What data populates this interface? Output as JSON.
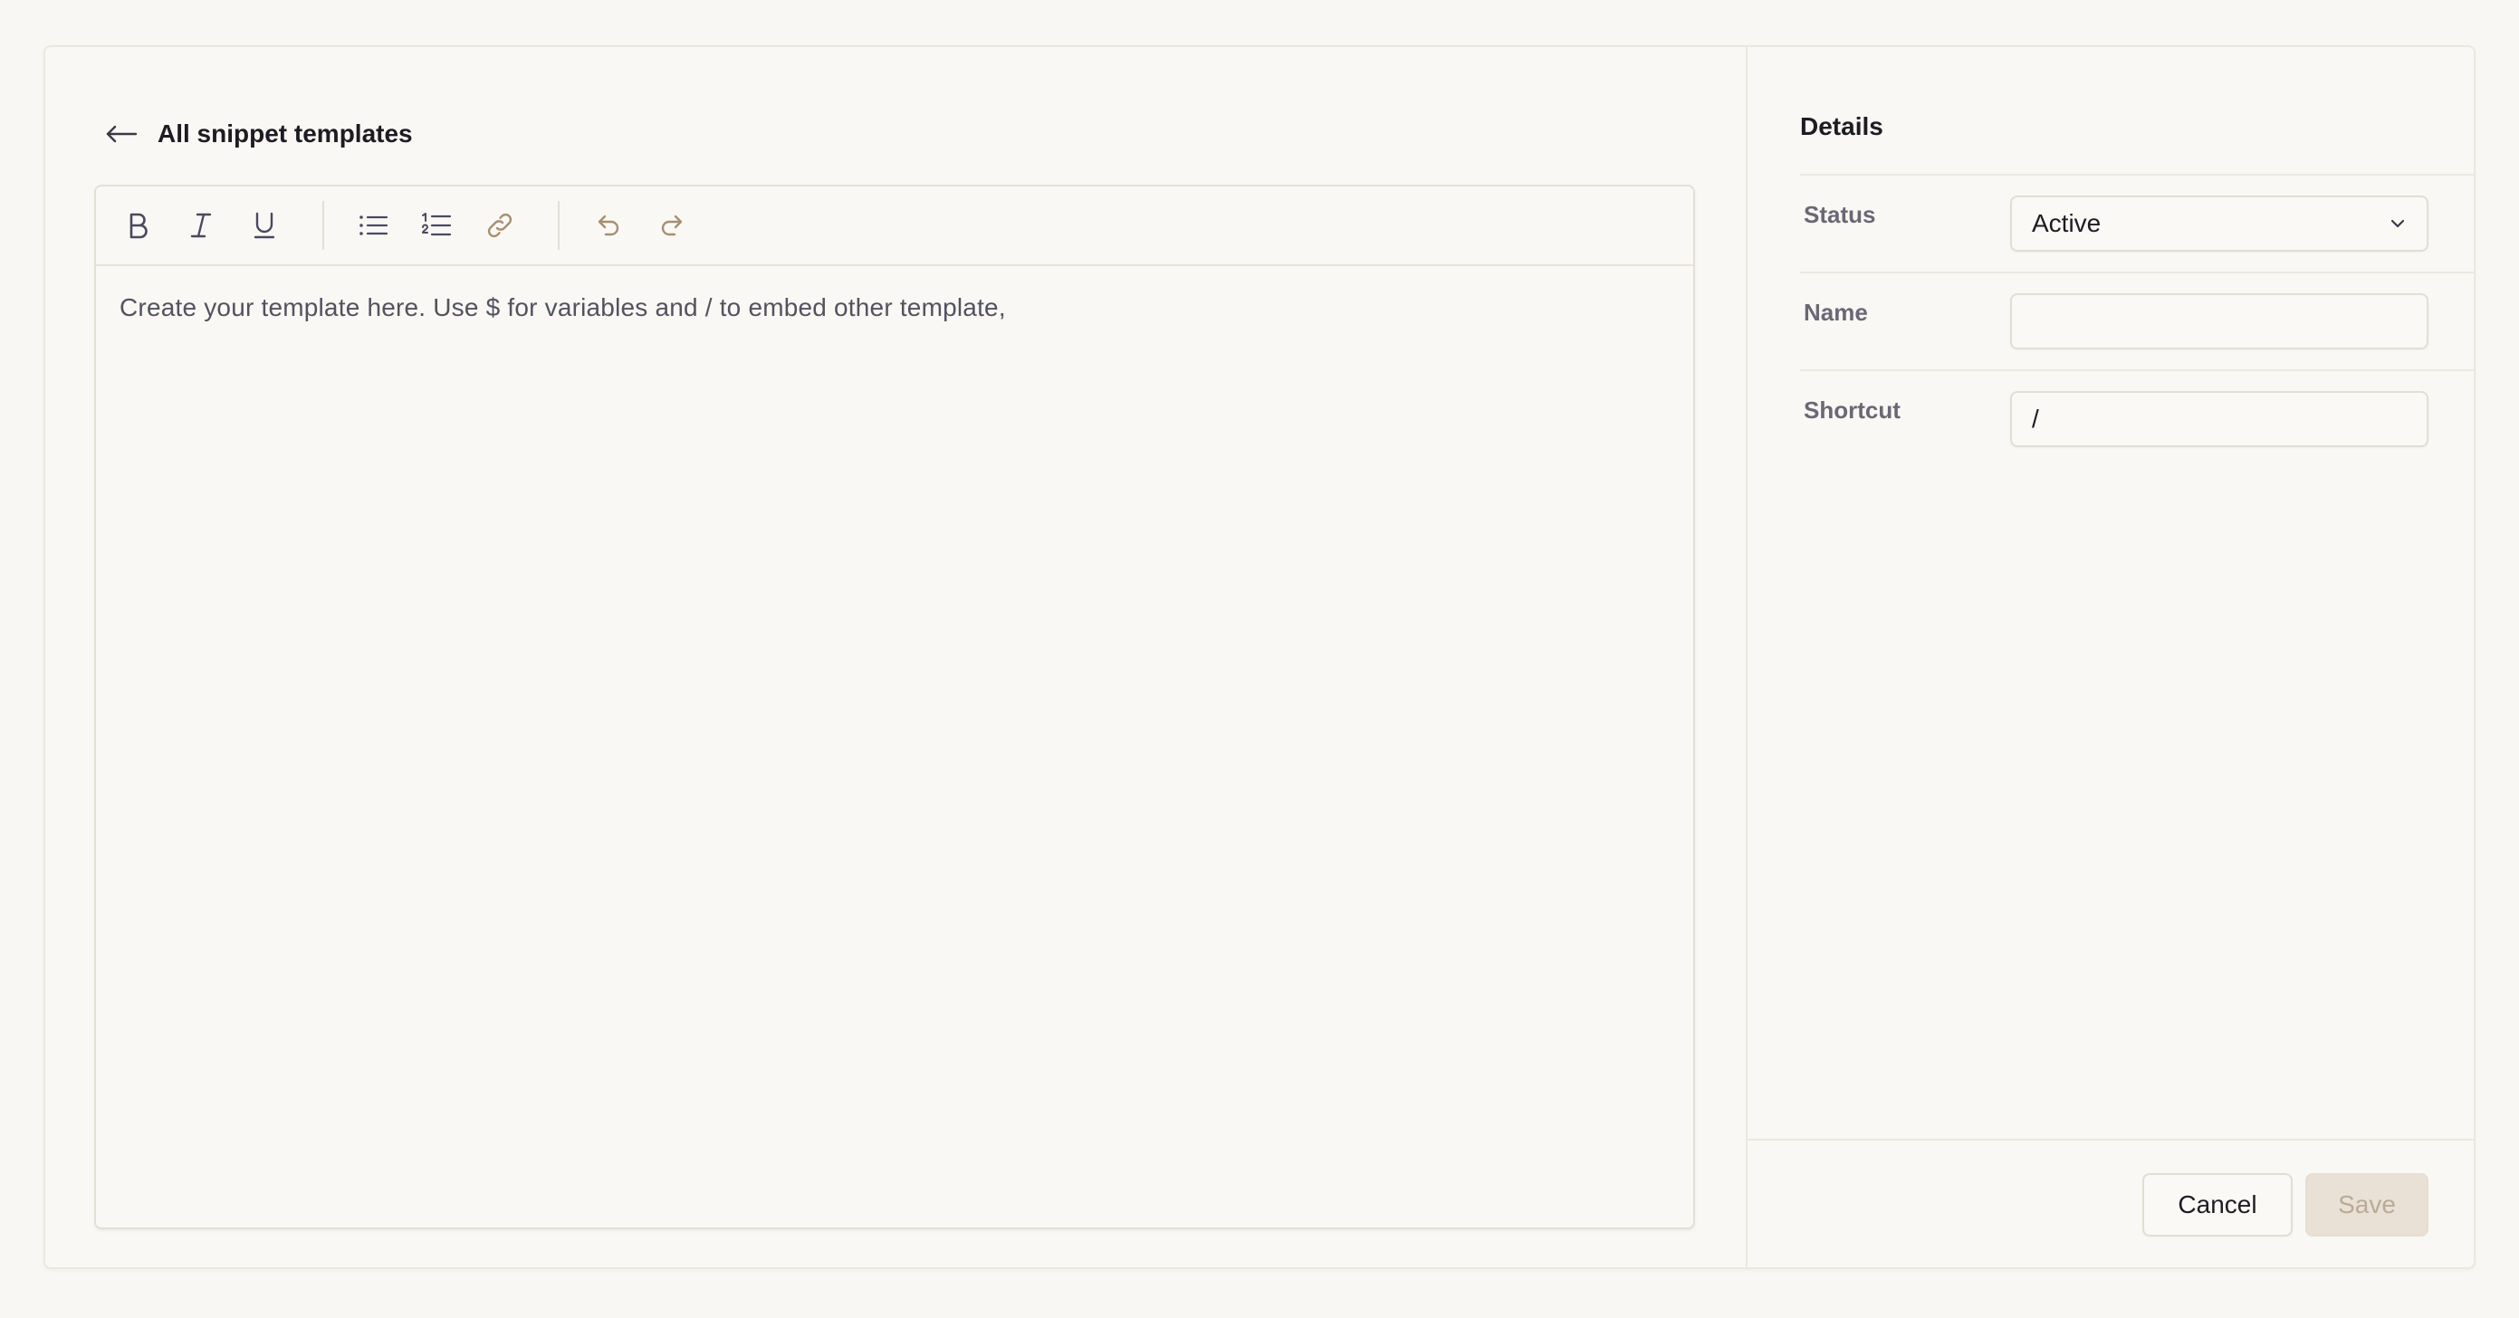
{
  "header": {
    "back_label": "All snippet templates",
    "back_icon": "arrow-left-icon"
  },
  "toolbar": {
    "groups": [
      [
        "bold-icon",
        "italic-icon",
        "underline-icon"
      ],
      [
        "bullet-list-icon",
        "numbered-list-icon",
        "link-icon"
      ],
      [
        "undo-icon",
        "redo-icon"
      ]
    ]
  },
  "editor": {
    "placeholder": "Create your template here. Use $ for variables and / to embed other template,"
  },
  "details": {
    "title": "Details",
    "status": {
      "label": "Status",
      "value": "Active"
    },
    "name": {
      "label": "Name",
      "value": ""
    },
    "shortcut": {
      "label": "Shortcut",
      "value": "/"
    }
  },
  "actions": {
    "cancel_label": "Cancel",
    "save_label": "Save"
  },
  "colors": {
    "background": "#f8f7f3",
    "text": "#1d1c22",
    "icon_default": "#4a4960",
    "icon_accent": "#a78f72",
    "save_disabled_bg": "#e9e1d6",
    "save_disabled_text": "#b9ab98"
  }
}
